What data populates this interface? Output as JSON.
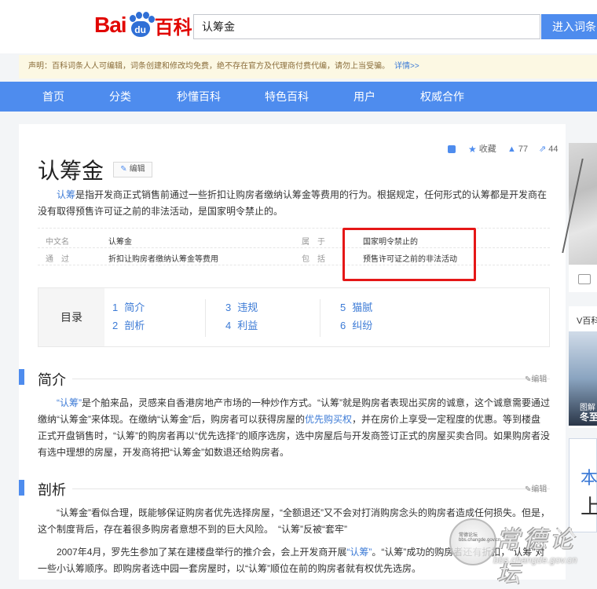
{
  "header": {
    "logo_bai": "Bai",
    "logo_du": "du",
    "logo_baike": "百科",
    "search_value": "认筹金",
    "search_button": "进入词条"
  },
  "notice": {
    "text": "声明：百科词条人人可编辑，词条创建和修改均免费，绝不存在官方及代理商付费代编，请勿上当受骗。",
    "link": "详情>>"
  },
  "nav": [
    "首页",
    "分类",
    "秒懂百科",
    "特色百科",
    "用户",
    "权威合作"
  ],
  "toolbar": {
    "collect": "收藏",
    "likes": "77",
    "shares": "44"
  },
  "article": {
    "title": "认筹金",
    "edit_label": "编辑",
    "summary_link": "认筹",
    "summary_text": "是指开发商正式销售前通过一些折扣让购房者缴纳认筹金等费用的行为。根据规定，任何形式的认筹都是开发商在没有取得预售许可证之前的非法活动，是国家明令禁止的。"
  },
  "infobox": {
    "row1": {
      "label1": "中文名",
      "value1": "认筹金",
      "label2": "属　于",
      "value2": "国家明令禁止的"
    },
    "row2": {
      "label1": "通　过",
      "value1": "折扣让购房者缴纳认筹金等费用",
      "label2": "包　括",
      "value2": "预售许可证之前的非法活动"
    }
  },
  "toc": {
    "heading": "目录",
    "items": [
      {
        "num": "1",
        "label": "简介"
      },
      {
        "num": "2",
        "label": "剖析"
      },
      {
        "num": "3",
        "label": "违规"
      },
      {
        "num": "4",
        "label": "利益"
      },
      {
        "num": "5",
        "label": "猫腻"
      },
      {
        "num": "6",
        "label": "纠纷"
      }
    ]
  },
  "sections": {
    "intro": {
      "title": "简介",
      "edit": "编辑",
      "p1_link1": "“认筹”",
      "p1_a": "是个舶来品，灵感来自香港房地产市场的一种炒作方式。“认筹”就是购房者表现出买房的诚意，这个诚意需要通过缴纳“认筹金”来体现。在缴纳“认筹金”后，购房者可以获得房屋的",
      "p1_link2": "优先购买权",
      "p1_b": "，并在房价上享受一定程度的优惠。等到楼盘正式开盘销售时，“认筹”的购房者再以“优先选择”的顺序选房，选中房屋后与开发商签订正式的房屋买卖合同。如果购房者没有选中理想的房屋，开发商将把“认筹金”如数退还给购房者。"
    },
    "analysis": {
      "title": "剖析",
      "edit": "编辑",
      "p1": "“认筹金”看似合理，既能够保证购房者优先选择房屋，“全额退还”又不会对打消购房念头的购房者造成任何损失。但是，这个制度背后，存在着很多购房者意想不到的巨大风险。　“认筹”反被“套牢”",
      "p2_a": "2007年4月，罗先生参加了某在建楼盘举行的推介会，会上开发商开展",
      "p2_link": "“认筹”",
      "p2_b": "。“认筹”成功的购房者还有折扣，“认筹”对一些小认筹顺序。即购房者选中园一套房屋时，以“认筹”顺位在前的购房者就有权优先选房。"
    }
  },
  "sidebar": {
    "card2_label": "V百科",
    "card2_cap1": "图解",
    "card2_cap2": "冬至",
    "card3_t1": "本",
    "card3_t2": "上"
  },
  "watermark": {
    "text": "常德论坛",
    "url": "bbs.changde.gov.cn",
    "seal_text": "常德论坛 bbs.changde.gov.cn"
  }
}
